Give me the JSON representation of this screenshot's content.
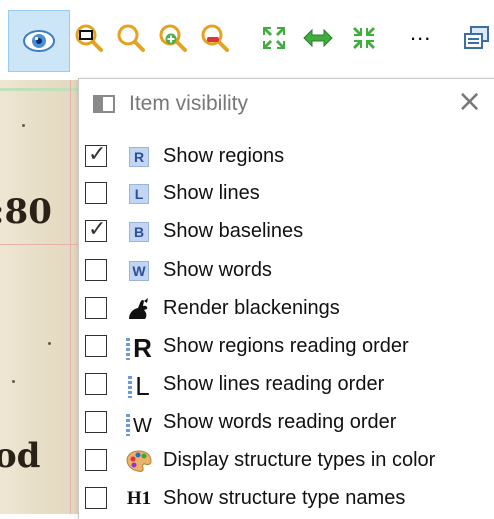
{
  "toolbar": {
    "buttons": [
      {
        "name": "eye-icon",
        "active": true
      },
      {
        "name": "zoom-selection-icon"
      },
      {
        "name": "zoom-icon"
      },
      {
        "name": "zoom-in-icon"
      },
      {
        "name": "zoom-out-icon"
      },
      {
        "name": "fit-page-icon"
      },
      {
        "name": "fit-width-icon"
      },
      {
        "name": "fit-height-icon"
      }
    ],
    "more_label": "..."
  },
  "document": {
    "fragments": [
      ":80",
      "od"
    ]
  },
  "panel": {
    "title": "Item visibility",
    "close_label": "×",
    "items": [
      {
        "label": "Show regions",
        "checked": true,
        "icon": "regions-badge-icon",
        "badge": "R"
      },
      {
        "label": "Show lines",
        "checked": false,
        "icon": "lines-badge-icon",
        "badge": "L"
      },
      {
        "label": "Show baselines",
        "checked": true,
        "icon": "baselines-badge-icon",
        "badge": "B"
      },
      {
        "label": "Show words",
        "checked": false,
        "icon": "words-badge-icon",
        "badge": "W"
      },
      {
        "label": "Render blackenings",
        "checked": false,
        "icon": "blackening-icon"
      },
      {
        "label": "Show regions reading order",
        "checked": false,
        "icon": "regions-reading-order-icon",
        "badge": "R"
      },
      {
        "label": "Show lines reading order",
        "checked": false,
        "icon": "lines-reading-order-icon",
        "badge": "L"
      },
      {
        "label": "Show words reading order",
        "checked": false,
        "icon": "words-reading-order-icon",
        "badge": "W"
      },
      {
        "label": "Display structure types in color",
        "checked": false,
        "icon": "palette-icon"
      },
      {
        "label": "Show structure type names",
        "checked": false,
        "icon": "structure-names-icon",
        "badge": "H1"
      }
    ]
  },
  "colors": {
    "accent_active": "#cde6f7",
    "badge_bg": "#c2d6f3",
    "badge_text": "#2b4f9a"
  }
}
